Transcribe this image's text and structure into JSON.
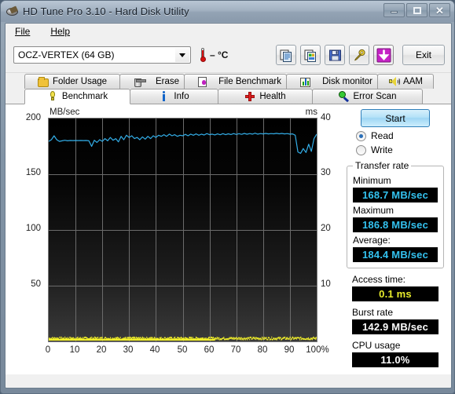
{
  "window": {
    "title": "HD Tune Pro 3.10 - Hard Disk Utility",
    "app_icon": "hard-disk-icon",
    "minimize": "–",
    "maximize": "□",
    "close": "✕"
  },
  "menubar": {
    "items": [
      {
        "label": "File"
      },
      {
        "label": "Help"
      }
    ]
  },
  "toolbar": {
    "device": "OCZ-VERTEX (64 GB)",
    "temperature": "– °C",
    "buttons": [
      {
        "name": "copy-icon",
        "tooltip": "Copy"
      },
      {
        "name": "copy-image-icon",
        "tooltip": "Copy image"
      },
      {
        "name": "save-icon",
        "tooltip": "Save"
      },
      {
        "name": "options-icon",
        "tooltip": "Options"
      },
      {
        "name": "download-icon",
        "tooltip": "Update"
      }
    ],
    "exit_label": "Exit"
  },
  "tabs": {
    "top_row": [
      {
        "label": "Folder Usage",
        "icon": "folder-icon",
        "active": false
      },
      {
        "label": "Erase",
        "icon": "trash-icon",
        "active": false
      },
      {
        "label": "File Benchmark",
        "icon": "file-benchmark-icon",
        "active": false
      },
      {
        "label": "Disk monitor",
        "icon": "bar-chart-icon",
        "active": false
      },
      {
        "label": "AAM",
        "icon": "speaker-icon",
        "active": false
      }
    ],
    "bottom_row": [
      {
        "label": "Benchmark",
        "icon": "lightbulb-icon",
        "active": true
      },
      {
        "label": "Info",
        "icon": "info-icon",
        "active": false
      },
      {
        "label": "Health",
        "icon": "red-cross-icon",
        "active": false
      },
      {
        "label": "Error Scan",
        "icon": "magnifier-icon",
        "active": false
      }
    ]
  },
  "side": {
    "start_label": "Start",
    "mode_read": "Read",
    "mode_write": "Write",
    "mode_selected": "Read",
    "transfer_rate_legend": "Transfer rate",
    "minimum_label": "Minimum",
    "minimum_value": "168.7 MB/sec",
    "maximum_label": "Maximum",
    "maximum_value": "186.8 MB/sec",
    "average_label": "Average:",
    "average_value": "184.4 MB/sec",
    "access_time_label": "Access time:",
    "access_time_value": "0.1 ms",
    "burst_rate_label": "Burst rate",
    "burst_rate_value": "142.9 MB/sec",
    "cpu_usage_label": "CPU usage",
    "cpu_usage_value": "11.0%"
  },
  "colors": {
    "transfer_line": "#33aee8",
    "access_dots": "#f2f02a",
    "lcd_cyan": "#33c2f0",
    "lcd_yellow": "#e8ec2c",
    "plot_bg": "#000000",
    "grid": "#6e6e6e"
  },
  "chart_data": {
    "type": "line",
    "title": "",
    "left_axis_label": "MB/sec",
    "right_axis_label": "ms",
    "xlabel": "%",
    "ylabel": "MB/sec",
    "ylim": [
      0,
      200
    ],
    "y_ticks": [
      50,
      100,
      150,
      200
    ],
    "y2lim": [
      0,
      40
    ],
    "y2_ticks": [
      10,
      20,
      30,
      40
    ],
    "xlim": [
      0,
      100
    ],
    "x_ticks": [
      "0",
      "10",
      "20",
      "30",
      "40",
      "50",
      "60",
      "70",
      "80",
      "90",
      "100%"
    ],
    "grid": true,
    "series": [
      {
        "name": "Transfer rate",
        "color": "#33aee8",
        "axis": "left",
        "units": "MB/sec",
        "x": [
          0,
          1,
          2,
          3,
          4,
          5,
          6,
          7,
          8,
          9,
          10,
          11,
          12,
          13,
          14,
          15,
          16,
          17,
          18,
          19,
          20,
          21,
          22,
          23,
          24,
          25,
          26,
          27,
          28,
          29,
          30,
          31,
          32,
          33,
          34,
          35,
          36,
          37,
          38,
          39,
          40,
          41,
          42,
          43,
          44,
          45,
          46,
          47,
          48,
          49,
          50,
          51,
          52,
          53,
          54,
          55,
          56,
          57,
          58,
          59,
          60,
          61,
          62,
          63,
          64,
          65,
          66,
          67,
          68,
          69,
          70,
          71,
          72,
          73,
          74,
          75,
          76,
          77,
          78,
          79,
          80,
          81,
          82,
          83,
          84,
          85,
          86,
          87,
          88,
          89,
          90,
          91,
          92,
          93,
          94,
          95,
          96,
          97,
          98,
          99,
          100
        ],
        "y": [
          179.5,
          181.0,
          184.5,
          181.0,
          179.5,
          180.0,
          180.5,
          180.0,
          180.3,
          180.2,
          180.3,
          180.2,
          180.3,
          180.2,
          180.3,
          180.0,
          175.0,
          180.5,
          178.5,
          181.0,
          179.5,
          182.0,
          180.0,
          183.0,
          180.5,
          182.0,
          179.0,
          184.0,
          181.0,
          185.0,
          183.0,
          184.5,
          182.0,
          183.0,
          181.0,
          183.5,
          181.5,
          184.0,
          182.0,
          184.5,
          183.0,
          185.0,
          184.0,
          185.5,
          184.0,
          186.0,
          184.5,
          185.5,
          184.0,
          185.0,
          184.5,
          185.8,
          184.5,
          186.0,
          185.0,
          186.2,
          185.0,
          186.0,
          185.2,
          186.5,
          185.5,
          186.0,
          185.3,
          186.2,
          185.4,
          186.4,
          185.5,
          186.3,
          185.6,
          186.5,
          185.7,
          186.4,
          185.8,
          186.6,
          185.9,
          186.5,
          186.0,
          186.8,
          186.0,
          186.5,
          186.2,
          186.6,
          186.2,
          186.5,
          186.3,
          186.7,
          186.3,
          186.6,
          186.2,
          186.5,
          186.0,
          186.2,
          185.0,
          170.0,
          168.7,
          173.0,
          169.5,
          177.0,
          170.5,
          182.0,
          186.0
        ]
      },
      {
        "name": "Access time",
        "color": "#f2f02a",
        "axis": "right",
        "units": "ms",
        "description": "Dense cluster of access-time dots along the bottom of the plot, all near 0.1 ms",
        "x_range": [
          0,
          100
        ],
        "y_typical": 0.1
      }
    ]
  }
}
